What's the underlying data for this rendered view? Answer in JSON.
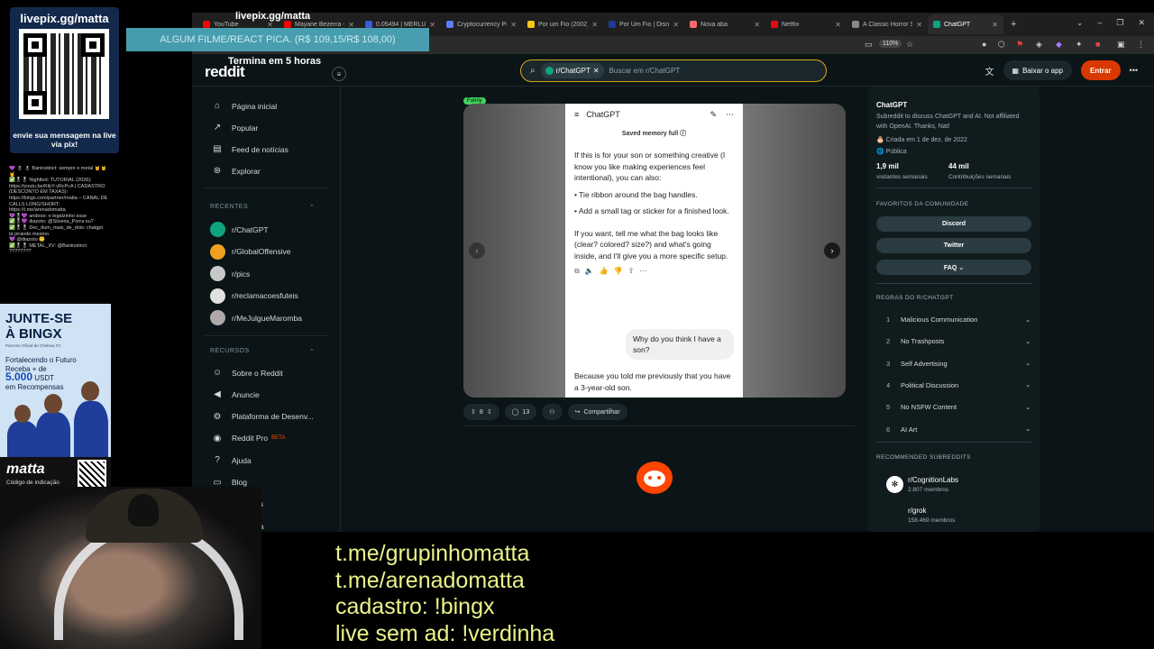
{
  "browser": {
    "tabs": [
      {
        "title": "YouTube",
        "color": "#ff0000"
      },
      {
        "title": "Mayane Bezerra - YouTube",
        "color": "#ff0000"
      },
      {
        "title": "0.05494 | MERLUSD",
        "color": "#3b5bdb"
      },
      {
        "title": "Cryptocurrency Prices",
        "color": "#5c7cfa"
      },
      {
        "title": "Por um Fio (2002) -",
        "color": "#f5c518"
      },
      {
        "title": "Por Um Fio | Disney+",
        "color": "#1b3a9c"
      },
      {
        "title": "Nova aba",
        "color": "#ff6b6b"
      },
      {
        "title": "Netflix",
        "color": "#e50914"
      },
      {
        "title": "A Classic Horror Story",
        "color": "#888888"
      },
      {
        "title": "ChatGPT",
        "color": "#10a37f",
        "active": true
      }
    ],
    "new_tab": "+",
    "window_controls": [
      "⌄",
      "–",
      "❐",
      "✕"
    ],
    "zoom": "110%"
  },
  "reddit": {
    "logo": "reddit",
    "search": {
      "chip": "r/ChatGPT",
      "chip_close": "✕",
      "placeholder": "Buscar em r/ChatGPT"
    },
    "header": {
      "get_app": "Baixar o app",
      "login": "Entrar",
      "more": "•••"
    },
    "nav": {
      "main": [
        {
          "label": "Página inicial",
          "icon": "⌂"
        },
        {
          "label": "Popular",
          "icon": "↗"
        },
        {
          "label": "Feed de notícias",
          "icon": "▤"
        },
        {
          "label": "Explorar",
          "icon": "⊛"
        }
      ],
      "recent_header": "RECENTES",
      "recent": [
        {
          "label": "r/ChatGPT",
          "color": "#10a37f"
        },
        {
          "label": "r/GlobalOffensive",
          "color": "#f0a020"
        },
        {
          "label": "r/pics",
          "color": "#c8c8c8"
        },
        {
          "label": "r/reclamacoesfuteis",
          "color": "#e0e0e0"
        },
        {
          "label": "r/MeJulgueMaromba",
          "color": "#b0a8a8"
        }
      ],
      "resources_header": "RECURSOS",
      "resources": [
        {
          "label": "Sobre o Reddit",
          "icon": "☺"
        },
        {
          "label": "Anuncie",
          "icon": "◀"
        },
        {
          "label": "Plataforma de Desenv...",
          "icon": "⚙"
        },
        {
          "label": "Reddit Pro",
          "icon": "◉",
          "badge": "BETA"
        },
        {
          "label": "Ajuda",
          "icon": "?"
        },
        {
          "label": "Blog",
          "icon": "▭"
        },
        {
          "label": "Carreiras",
          "icon": "▣"
        },
        {
          "label": "Imprensa",
          "icon": "▦"
        }
      ]
    },
    "post": {
      "flair": "Funny",
      "screenshot": {
        "app_title": "ChatGPT",
        "memory_notice": "Saved memory full ⓘ",
        "p1": "If this is for your son or something creative (I know you like making experiences feel intentional), you can also:",
        "bullet1": "• Tie ribbon around the bag handles.",
        "bullet2": "• Add a small tag or sticker for a finished look.",
        "p2": "If you want, tell me what the bag looks like (clear? colored? size?) and what's going inside, and I'll give you a more specific setup.",
        "user_msg": "Why do you think I have a son?",
        "p3": "Because you told me previously that you have a 3-year-old son."
      },
      "votes": "8",
      "comments": "13",
      "share": "Compartilhar"
    },
    "sidebar": {
      "name": "ChatGPT",
      "description": "Subreddit to discuss ChatGPT and AI. Not affiliated with OpenAI. Thanks, Nat!",
      "created": "Criada em 1 de dez. de 2022",
      "visibility": "Pública",
      "weekly_visitors": "1,9 mil",
      "weekly_visitors_label": "visitantes semanais",
      "weekly_contribs": "44 mil",
      "weekly_contribs_label": "Contribuições semanais",
      "favorites_header": "FAVORITOS DA COMUNIDADE",
      "favorites": [
        "Discord",
        "Twitter",
        "FAQ ⌄"
      ],
      "rules_header": "REGRAS DO R/CHATGPT",
      "rules": [
        {
          "n": "1",
          "label": "Malicious Communication"
        },
        {
          "n": "2",
          "label": "No Trashposts"
        },
        {
          "n": "3",
          "label": "Self Advertising"
        },
        {
          "n": "4",
          "label": "Political Discussion"
        },
        {
          "n": "5",
          "label": "No NSFW Content"
        },
        {
          "n": "6",
          "label": "AI Art"
        }
      ],
      "recommended_header": "RECOMMENDED SUBREDDITS",
      "recommended": [
        {
          "name": "r/CognitionLabs",
          "members": "2.807 membros"
        },
        {
          "name": "r/grok",
          "members": "158.469 membros"
        }
      ]
    }
  },
  "overlay": {
    "pix_url": "livepix.gg/matta",
    "pix_message": "envie sua mensagem na live via pix!",
    "pix_banner_url": "livepix.gg/matta",
    "pix_banner": "ALGUM FILME/REACT PICA. (R$ 109,15/R$ 108,00)",
    "pix_banner_timer": "Termina em 5 horas",
    "chat": [
      "💜 🎖 🎖 Baninstinct: sempre o metal 🤘🤘🤘",
      "✅🎖🎖 Nightbot: TUTORIAL (2026): https://youtu.be/KibY-vRcPcA | CADASTRO (DESCONTO EM TAXAS): https://bingx.com/partner/matta – CANAL DE CALLS LONG/SHORT: https://t.me/arenadomatta",
      "💜🎖💜 andooo: e legalzinho esse",
      "✅🎖💜 diazoto: @Silveira_Porra eu?",
      "✅🎖🎖 Dec_dum_mais_de_dois: chatgpt tá pirando mesmo",
      "💜 @diazoto 🙂",
      "✅🎖🎖 METAL_XV: @Baninstinct ????????"
    ],
    "bingx": {
      "title": "JUNTE-SE À BINGX",
      "sub": "Parceiro Oficial de Chelsea FC",
      "line1": "Fortalecendo o Futuro",
      "line2": "Receba + de",
      "amount": "5.000",
      "unit": "USDT",
      "line3": "em Recompensas"
    },
    "matta_logo": "matta",
    "matta_code": "Código de indicação",
    "socials": [
      "t.me/grupinhomatta",
      "t.me/arenadomatta",
      "cadastro: !bingx",
      "live sem ad: !verdinha"
    ]
  }
}
